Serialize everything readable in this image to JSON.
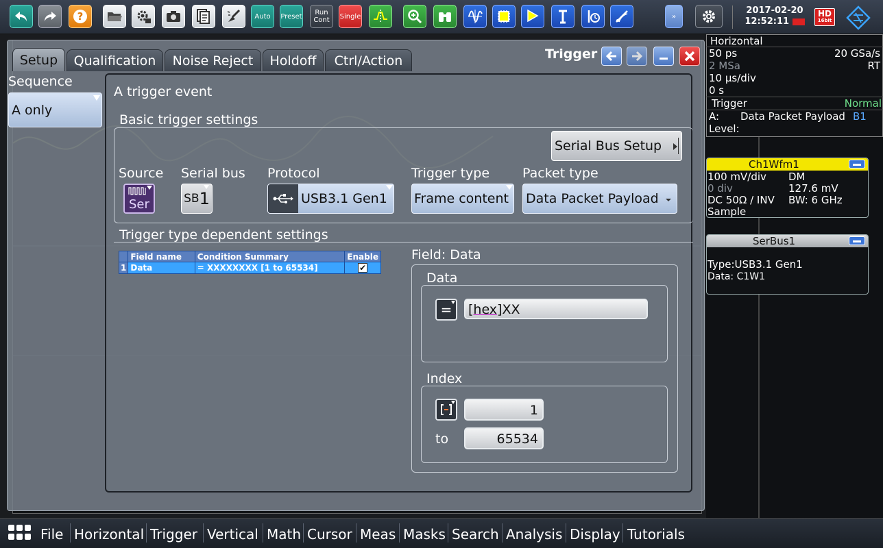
{
  "toolbar": {
    "auto": "Auto",
    "preset": "Preset",
    "run_cont_1": "Run",
    "run_cont_2": "Cont",
    "single": "Single",
    "date": "2017-02-20",
    "time": "12:52:11",
    "hd": "HD",
    "hd_sub": "16bit"
  },
  "dialog": {
    "title": "Trigger",
    "tabs": [
      "Setup",
      "Qualification",
      "Noise Reject",
      "Holdoff",
      "Ctrl/Action"
    ],
    "sequence_label": "Sequence",
    "sequence_value": "A only",
    "event_title": "A trigger event",
    "basic_title": "Basic trigger settings",
    "serial_bus_setup": "Serial Bus Setup",
    "source_label": "Source",
    "source_value": "Ser",
    "serial_bus_label": "Serial bus",
    "serial_bus_prefix": "SB",
    "serial_bus_value": "1",
    "protocol_label": "Protocol",
    "protocol_value": "USB3.1 Gen1",
    "trigger_type_label": "Trigger type",
    "trigger_type_value": "Frame content",
    "packet_type_label": "Packet type",
    "packet_type_value": "Data Packet Payload",
    "dependent_title": "Trigger type dependent settings",
    "table": {
      "headers": [
        "Field name",
        "Condition Summary",
        "Enable"
      ],
      "rows": [
        {
          "index": "1",
          "field": "Data",
          "condition": "= XXXXXXXX [1 to 65534]",
          "enabled": true
        }
      ]
    },
    "field_title": "Field: Data",
    "data_group": "Data",
    "data_operator": "=",
    "data_value_prefix": "[hex]",
    "data_value": "XX",
    "index_group": "Index",
    "index_from": "1",
    "index_to_label": "to",
    "index_to": "65534"
  },
  "info_panel": {
    "horizontal_title": "Horizontal",
    "h_resolution": "50 ps",
    "h_sample_rate": "20 GSa/s",
    "h_record": "2 MSa",
    "h_mode": "RT",
    "h_scale": "10 µs/div",
    "h_position": "0 s",
    "trigger_title": "Trigger",
    "trigger_mode": "Normal",
    "trigger_a_label": "A:",
    "trigger_a_value": "Data Packet Payload",
    "trigger_a_source": "B1",
    "trigger_level_label": "Level:",
    "ch1_title": "Ch1Wfm1",
    "ch1_scale": "100 mV/div",
    "ch1_mode": "DM",
    "ch1_offset": "0 div",
    "ch1_level": "127.6 mV",
    "ch1_coupling": "DC 50Ω / INV",
    "ch1_bw": "BW: 6 GHz",
    "ch1_acq": "Sample",
    "serbus_title": "SerBus1",
    "serbus_type_label": "Type:",
    "serbus_type": "USB3.1 Gen1",
    "serbus_data": "Data: C1W1"
  },
  "menu": [
    "File",
    "Horizontal",
    "Trigger",
    "Vertical",
    "Math",
    "Cursor",
    "Meas",
    "Masks",
    "Search",
    "Analysis",
    "Display",
    "Tutorials"
  ],
  "colors": {
    "accent_blue": "#3aa4ff",
    "toolbar_teal": "#1e8f84",
    "ch1_yellow": "#f3e600",
    "normal_green": "#6fe08b"
  }
}
